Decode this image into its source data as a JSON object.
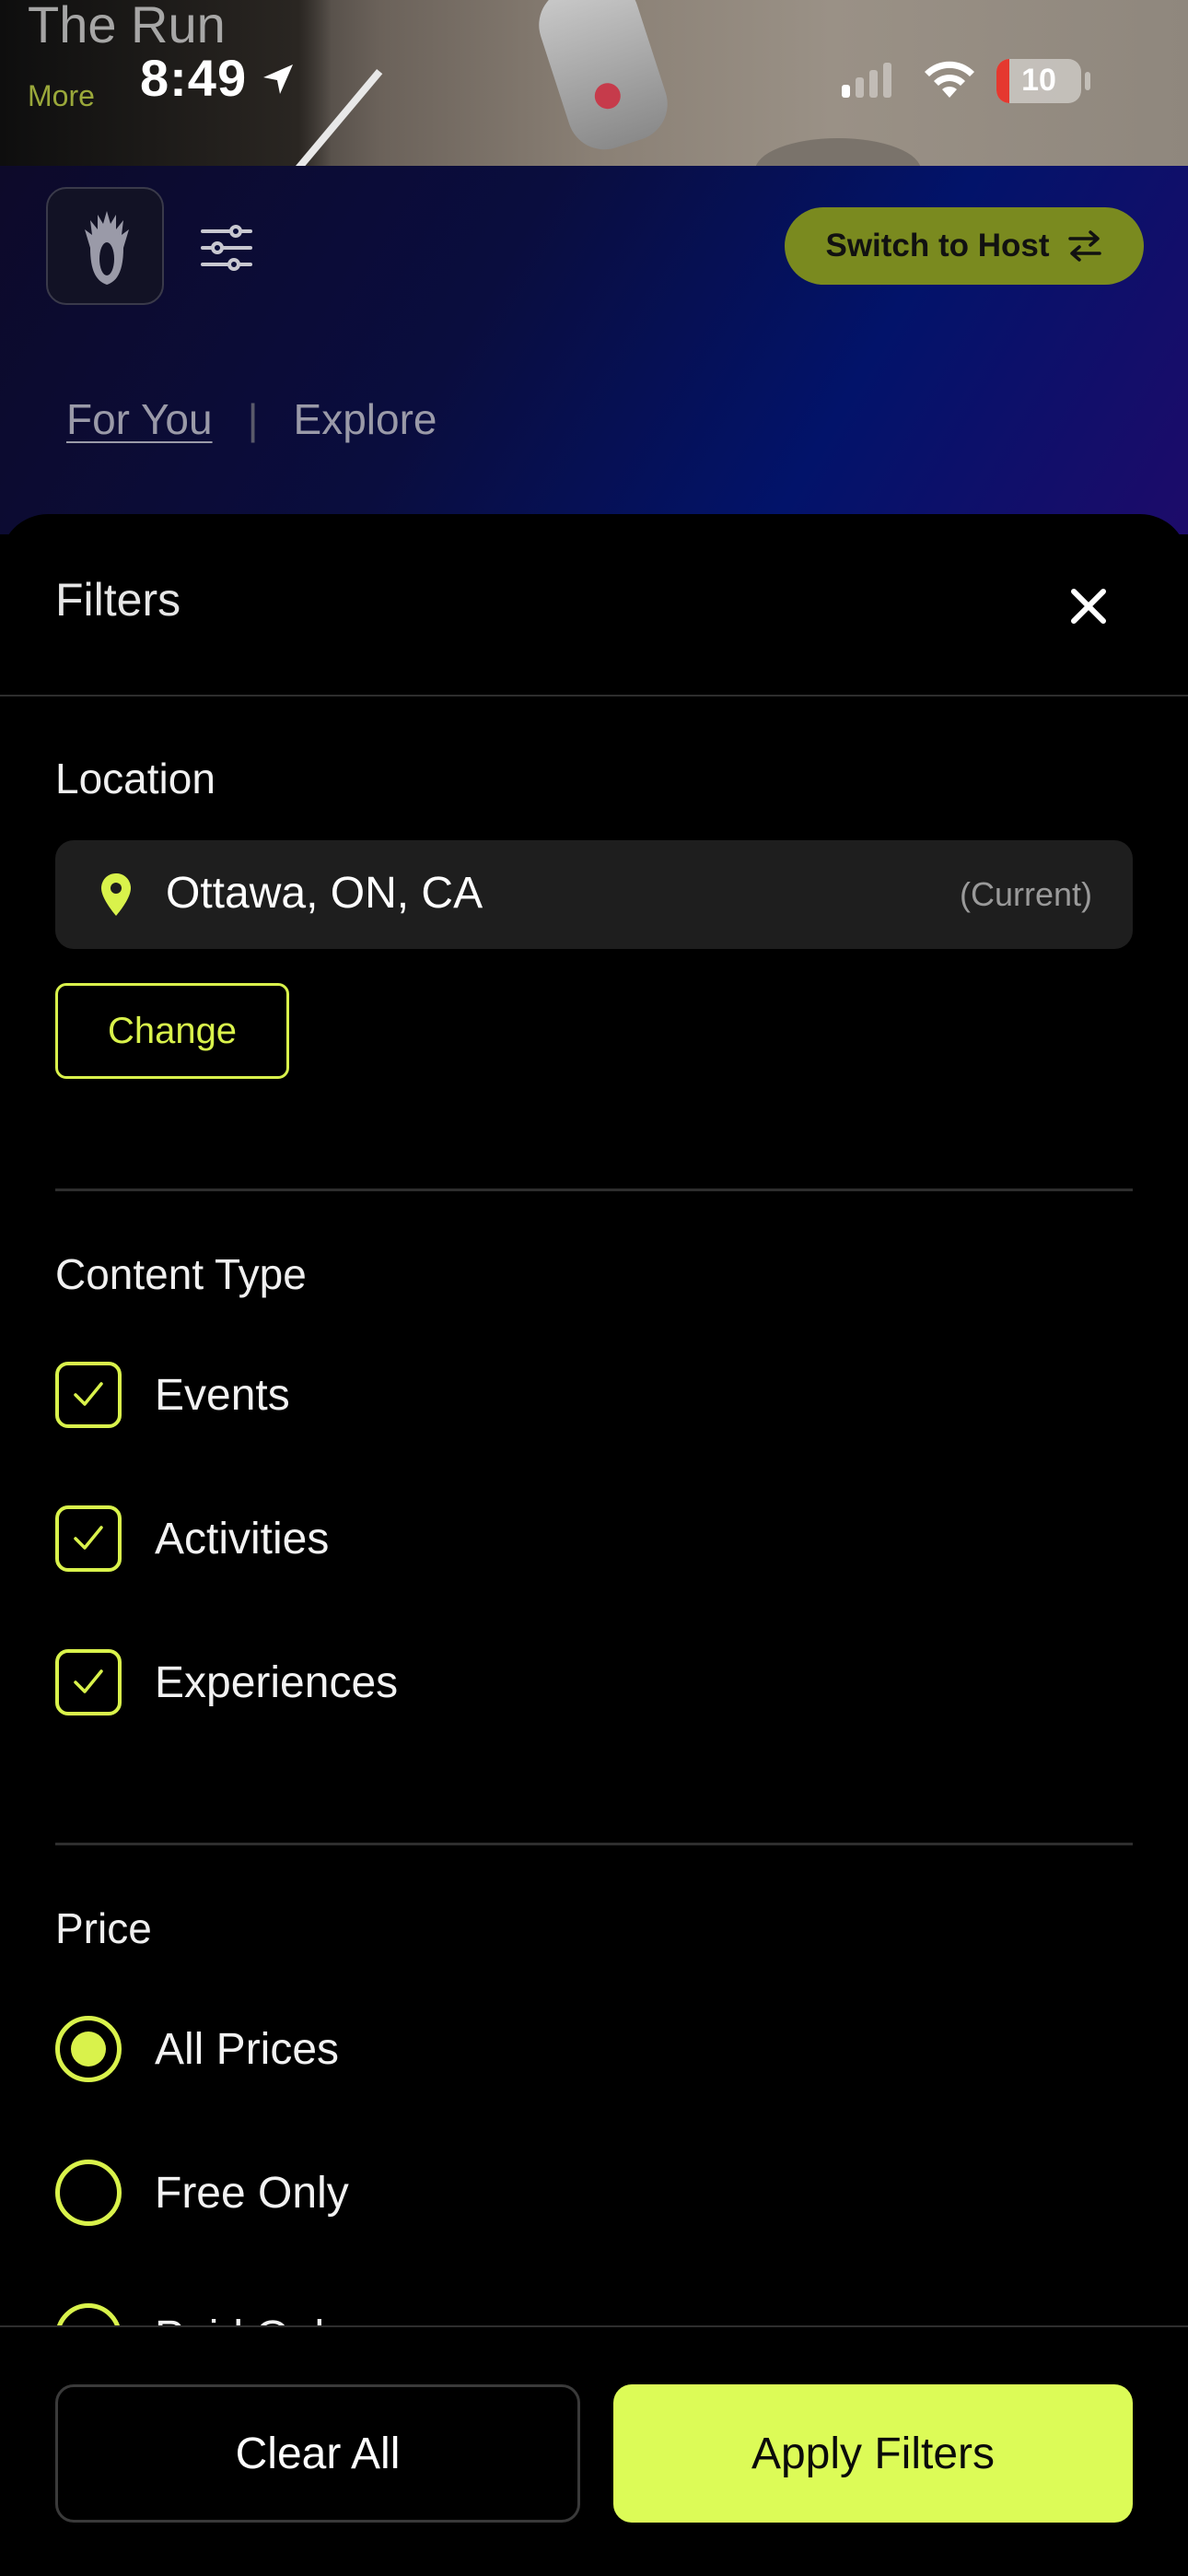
{
  "background": {
    "ghost_title": "The Run",
    "ghost_more": "More"
  },
  "status_bar": {
    "time": "8:49",
    "battery": "10",
    "icons": [
      "location-arrow-icon",
      "cellular-signal-icon",
      "wifi-icon",
      "battery-icon"
    ]
  },
  "header": {
    "switch_host_label": "Switch to Host",
    "tabs": [
      {
        "label": "For You",
        "active": true
      },
      {
        "label": "Explore",
        "active": false
      }
    ],
    "separator": "|"
  },
  "filters": {
    "title": "Filters",
    "location": {
      "label": "Location",
      "value": "Ottawa, ON, CA",
      "badge": "(Current)",
      "change_label": "Change"
    },
    "content_type": {
      "label": "Content Type",
      "options": [
        {
          "label": "Events",
          "checked": true
        },
        {
          "label": "Activities",
          "checked": true
        },
        {
          "label": "Experiences",
          "checked": true
        }
      ]
    },
    "price": {
      "label": "Price",
      "options": [
        {
          "label": "All Prices",
          "selected": true
        },
        {
          "label": "Free Only",
          "selected": false
        },
        {
          "label": "Paid Only",
          "selected": false
        }
      ]
    }
  },
  "actions": {
    "clear_label": "Clear All",
    "apply_label": "Apply Filters"
  },
  "colors": {
    "accent": "#d9f24b",
    "apply_bg": "#dcfb57",
    "switch_host_bg": "#7a8a1f",
    "sheet_bg": "#000000"
  }
}
